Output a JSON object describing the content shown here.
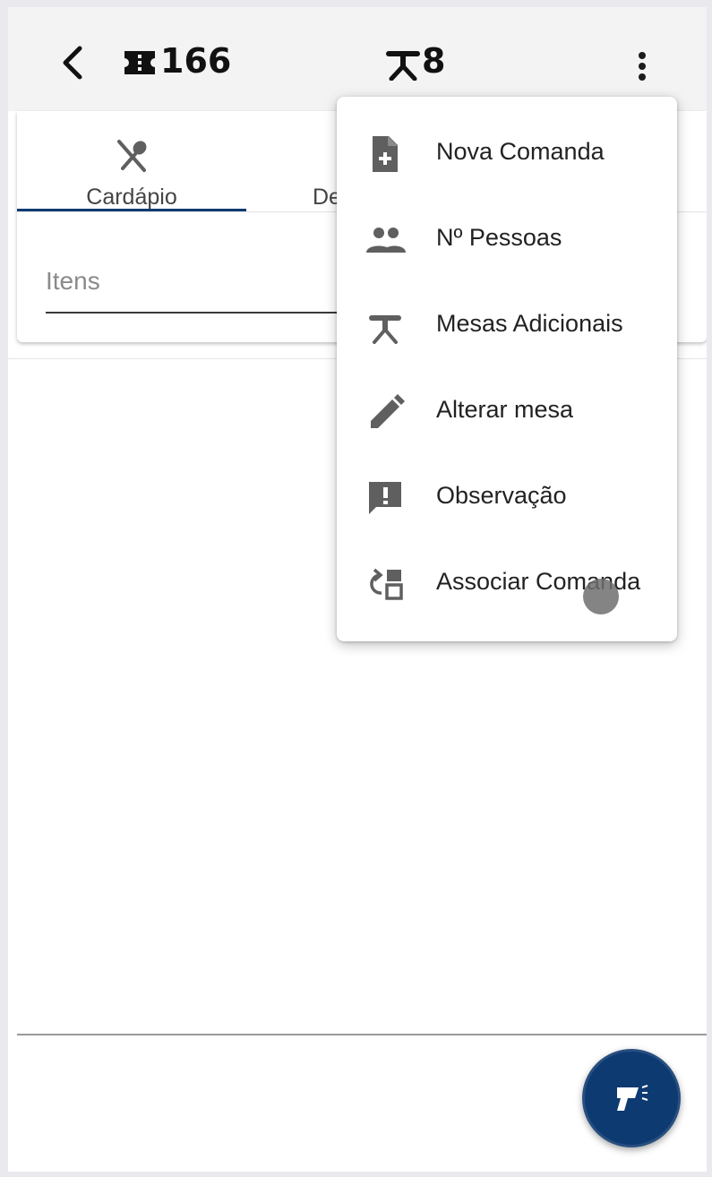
{
  "header": {
    "back_icon": "chevron-left-icon",
    "comanda_icon": "ticket-icon",
    "comanda_number": "166",
    "table_icon": "table-icon",
    "table_number": "8",
    "menu_icon": "more-vertical-icon"
  },
  "tabs": [
    {
      "label": "Cardápio",
      "icon": "fork-spoon-icon",
      "active": true
    },
    {
      "label": "De",
      "partial": true
    }
  ],
  "items_field": {
    "placeholder": "Itens",
    "value": ""
  },
  "menu": {
    "items": [
      {
        "label": "Nova Comanda",
        "icon": "file-plus-icon"
      },
      {
        "label": "Nº Pessoas",
        "icon": "people-icon"
      },
      {
        "label": "Mesas Adicionais",
        "icon": "table-icon"
      },
      {
        "label": "Alterar mesa",
        "icon": "pencil-icon"
      },
      {
        "label": "Observação",
        "icon": "feedback-icon"
      },
      {
        "label": "Associar Comanda",
        "icon": "link-comanda-icon"
      }
    ]
  },
  "fab": {
    "icon": "barcode-scanner-icon"
  },
  "colors": {
    "primary": "#0e3a72",
    "topbar_bg": "#f3f3f3",
    "icon_gray": "#5f5f5f"
  }
}
